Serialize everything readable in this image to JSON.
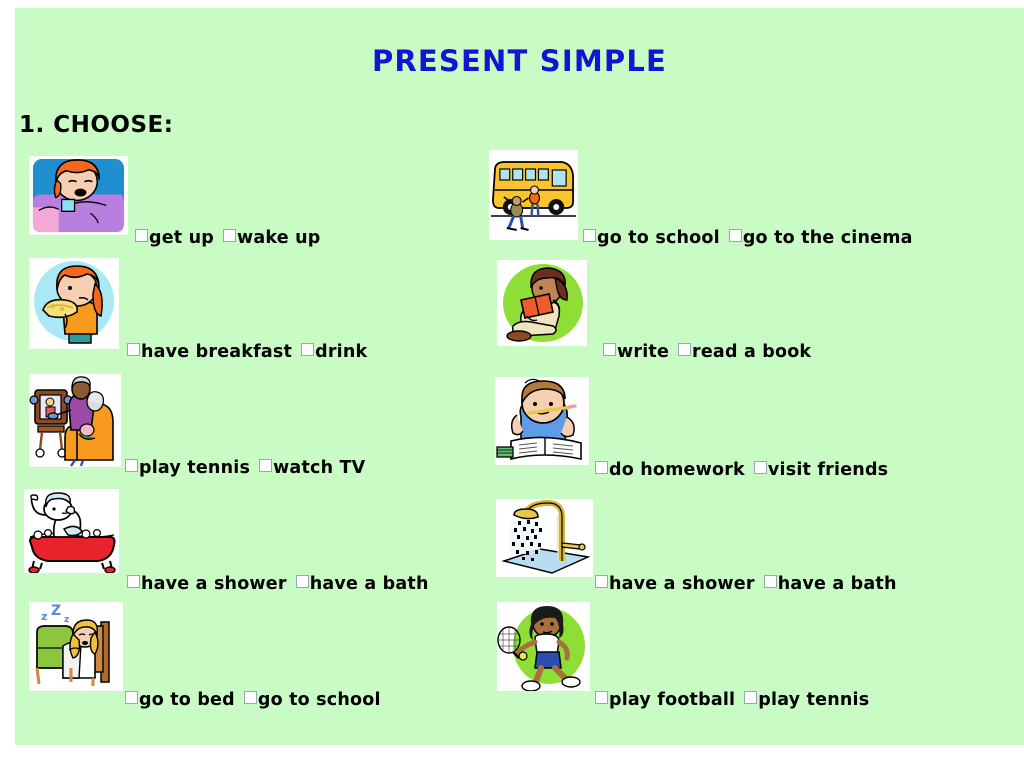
{
  "worksheet": {
    "title": "PRESENT SIMPLE",
    "instruction": "1. CHOOSE:",
    "title_color": "#1414d2",
    "page_background": "#c8fcc4",
    "text_color": "#000000"
  },
  "exercises": [
    {
      "image": "person-waking-up-in-bed",
      "options": [
        {
          "label": "get up",
          "checked": false
        },
        {
          "label": "wake up",
          "checked": false
        }
      ]
    },
    {
      "image": "school-bus-with-children",
      "options": [
        {
          "label": "go to school",
          "checked": false
        },
        {
          "label": "go to the cinema",
          "checked": false
        }
      ]
    },
    {
      "image": "child-eating-sandwich",
      "options": [
        {
          "label": "have breakfast",
          "checked": false
        },
        {
          "label": "drink",
          "checked": false
        }
      ]
    },
    {
      "image": "girl-reading-book",
      "options": [
        {
          "label": "write",
          "checked": false
        },
        {
          "label": "read a book",
          "checked": false
        }
      ]
    },
    {
      "image": "family-watching-television",
      "options": [
        {
          "label": "play tennis",
          "checked": false
        },
        {
          "label": "watch TV",
          "checked": false
        }
      ]
    },
    {
      "image": "boy-doing-homework",
      "options": [
        {
          "label": "do homework",
          "checked": false
        },
        {
          "label": "visit friends",
          "checked": false
        }
      ]
    },
    {
      "image": "person-in-bathtub",
      "options": [
        {
          "label": "have a shower",
          "checked": false
        },
        {
          "label": "have a bath",
          "checked": false
        }
      ]
    },
    {
      "image": "shower-head-running",
      "options": [
        {
          "label": "have a shower",
          "checked": false
        },
        {
          "label": "have a bath",
          "checked": false
        }
      ]
    },
    {
      "image": "girl-sleeping-in-bed",
      "options": [
        {
          "label": "go to bed",
          "checked": false
        },
        {
          "label": "go to school",
          "checked": false
        }
      ]
    },
    {
      "image": "girl-playing-tennis",
      "options": [
        {
          "label": "play football",
          "checked": false
        },
        {
          "label": "play tennis",
          "checked": false
        }
      ]
    }
  ]
}
